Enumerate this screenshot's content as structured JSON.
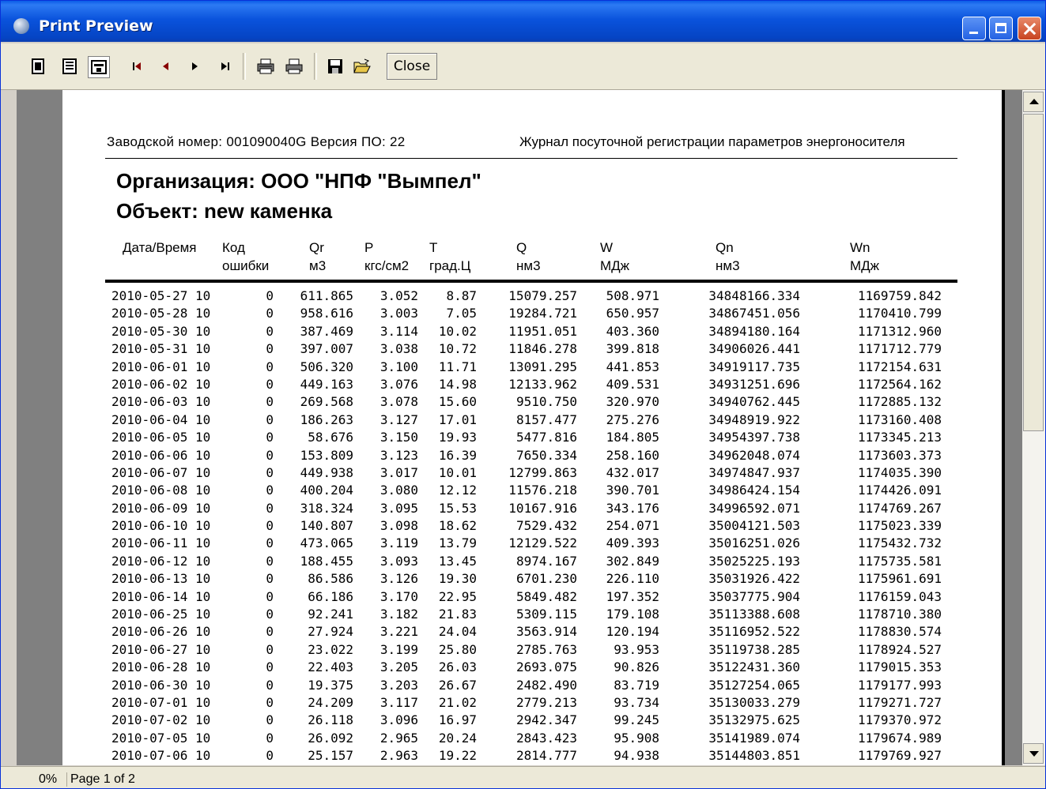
{
  "window": {
    "title": "Print Preview"
  },
  "toolbar": {
    "close_label": "Close",
    "tools": [
      "one-page-icon",
      "two-pages-icon",
      "page-width-icon",
      "first-page-icon",
      "prev-page-icon",
      "next-page-icon",
      "last-page-icon",
      "print-setup-icon",
      "print-icon",
      "save-icon",
      "open-icon"
    ]
  },
  "report": {
    "header_left": "Заводской номер: 001090040G  Версия ПО: 22",
    "header_right": "Журнал посуточной регистрации параметров энергоносителя",
    "organization": "Организация: ООО \"НПФ \"Вымпел\"",
    "object": "Объект: new каменка",
    "columns": [
      {
        "line1": "Дата/Время",
        "line2": ""
      },
      {
        "line1": "Код",
        "line2": "ошибки"
      },
      {
        "line1": "Qr",
        "line2": "м3"
      },
      {
        "line1": "P",
        "line2": "кгс/см2"
      },
      {
        "line1": "T",
        "line2": "град.Ц"
      },
      {
        "line1": "Q",
        "line2": "нм3"
      },
      {
        "line1": "W",
        "line2": "МДж"
      },
      {
        "line1": "Qn",
        "line2": "нм3"
      },
      {
        "line1": "Wn",
        "line2": "МДж"
      }
    ],
    "rows": [
      [
        "2010-05-27 10",
        "0",
        "611.865",
        "3.052",
        "8.87",
        "15079.257",
        "508.971",
        "34848166.334",
        "1169759.842"
      ],
      [
        "2010-05-28 10",
        "0",
        "958.616",
        "3.003",
        "7.05",
        "19284.721",
        "650.957",
        "34867451.056",
        "1170410.799"
      ],
      [
        "2010-05-30 10",
        "0",
        "387.469",
        "3.114",
        "10.02",
        "11951.051",
        "403.360",
        "34894180.164",
        "1171312.960"
      ],
      [
        "2010-05-31 10",
        "0",
        "397.007",
        "3.038",
        "10.72",
        "11846.278",
        "399.818",
        "34906026.441",
        "1171712.779"
      ],
      [
        "2010-06-01 10",
        "0",
        "506.320",
        "3.100",
        "11.71",
        "13091.295",
        "441.853",
        "34919117.735",
        "1172154.631"
      ],
      [
        "2010-06-02 10",
        "0",
        "449.163",
        "3.076",
        "14.98",
        "12133.962",
        "409.531",
        "34931251.696",
        "1172564.162"
      ],
      [
        "2010-06-03 10",
        "0",
        "269.568",
        "3.078",
        "15.60",
        "9510.750",
        "320.970",
        "34940762.445",
        "1172885.132"
      ],
      [
        "2010-06-04 10",
        "0",
        "186.263",
        "3.127",
        "17.01",
        "8157.477",
        "275.276",
        "34948919.922",
        "1173160.408"
      ],
      [
        "2010-06-05 10",
        "0",
        "58.676",
        "3.150",
        "19.93",
        "5477.816",
        "184.805",
        "34954397.738",
        "1173345.213"
      ],
      [
        "2010-06-06 10",
        "0",
        "153.809",
        "3.123",
        "16.39",
        "7650.334",
        "258.160",
        "34962048.074",
        "1173603.373"
      ],
      [
        "2010-06-07 10",
        "0",
        "449.938",
        "3.017",
        "10.01",
        "12799.863",
        "432.017",
        "34974847.937",
        "1174035.390"
      ],
      [
        "2010-06-08 10",
        "0",
        "400.204",
        "3.080",
        "12.12",
        "11576.218",
        "390.701",
        "34986424.154",
        "1174426.091"
      ],
      [
        "2010-06-09 10",
        "0",
        "318.324",
        "3.095",
        "15.53",
        "10167.916",
        "343.176",
        "34996592.071",
        "1174769.267"
      ],
      [
        "2010-06-10 10",
        "0",
        "140.807",
        "3.098",
        "18.62",
        "7529.432",
        "254.071",
        "35004121.503",
        "1175023.339"
      ],
      [
        "2010-06-11 10",
        "0",
        "473.065",
        "3.119",
        "13.79",
        "12129.522",
        "409.393",
        "35016251.026",
        "1175432.732"
      ],
      [
        "2010-06-12 10",
        "0",
        "188.455",
        "3.093",
        "13.45",
        "8974.167",
        "302.849",
        "35025225.193",
        "1175735.581"
      ],
      [
        "2010-06-13 10",
        "0",
        "86.586",
        "3.126",
        "19.30",
        "6701.230",
        "226.110",
        "35031926.422",
        "1175961.691"
      ],
      [
        "2010-06-14 10",
        "0",
        "66.186",
        "3.170",
        "22.95",
        "5849.482",
        "197.352",
        "35037775.904",
        "1176159.043"
      ],
      [
        "2010-06-25 10",
        "0",
        "92.241",
        "3.182",
        "21.83",
        "5309.115",
        "179.108",
        "35113388.608",
        "1178710.380"
      ],
      [
        "2010-06-26 10",
        "0",
        "27.924",
        "3.221",
        "24.04",
        "3563.914",
        "120.194",
        "35116952.522",
        "1178830.574"
      ],
      [
        "2010-06-27 10",
        "0",
        "23.022",
        "3.199",
        "25.80",
        "2785.763",
        "93.953",
        "35119738.285",
        "1178924.527"
      ],
      [
        "2010-06-28 10",
        "0",
        "22.403",
        "3.205",
        "26.03",
        "2693.075",
        "90.826",
        "35122431.360",
        "1179015.353"
      ],
      [
        "2010-06-30 10",
        "0",
        "19.375",
        "3.203",
        "26.67",
        "2482.490",
        "83.719",
        "35127254.065",
        "1179177.993"
      ],
      [
        "2010-07-01 10",
        "0",
        "24.209",
        "3.117",
        "21.02",
        "2779.213",
        "93.734",
        "35130033.279",
        "1179271.727"
      ],
      [
        "2010-07-02 10",
        "0",
        "26.118",
        "3.096",
        "16.97",
        "2942.347",
        "99.245",
        "35132975.625",
        "1179370.972"
      ],
      [
        "2010-07-05 10",
        "0",
        "26.092",
        "2.965",
        "20.24",
        "2843.423",
        "95.908",
        "35141989.074",
        "1179674.989"
      ],
      [
        "2010-07-06 10",
        "0",
        "25.157",
        "2.963",
        "19.22",
        "2814.777",
        "94.938",
        "35144803.851",
        "1179769.927"
      ]
    ]
  },
  "status": {
    "zoom": "0%",
    "page": "Page 1 of 2"
  }
}
